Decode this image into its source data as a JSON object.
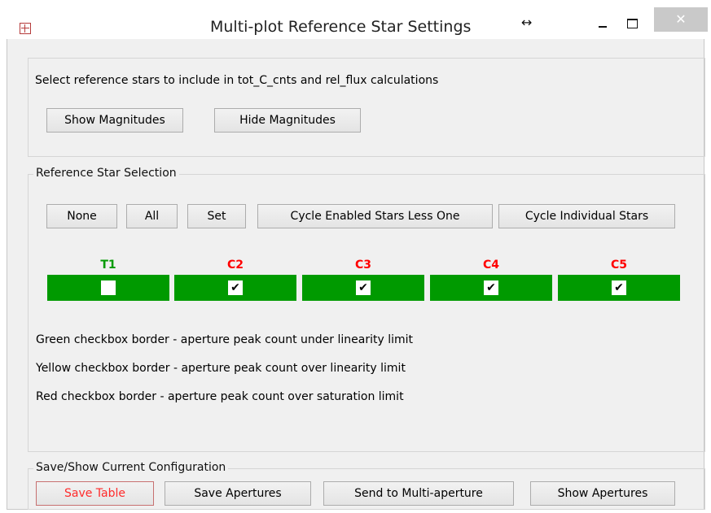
{
  "window": {
    "title": "Multi-plot Reference Star Settings",
    "resize_glyph": "↔",
    "close_glyph": "✕",
    "icons": {
      "app": "plot-app-icon",
      "resize": "horizontal-resize-icon",
      "minimize": "minimize-icon",
      "maximize": "maximize-icon",
      "close": "close-icon"
    }
  },
  "display_panel": {
    "instruction": "Select reference stars to include in tot_C_cnts and rel_flux calculations",
    "show_magnitudes": "Show Magnitudes",
    "hide_magnitudes": "Hide Magnitudes"
  },
  "selection_panel": {
    "legend": "Reference Star Selection",
    "buttons": {
      "none": "None",
      "all": "All",
      "set": "Set",
      "cycle_enabled": "Cycle Enabled Stars Less One",
      "cycle_individual": "Cycle Individual Stars"
    },
    "stars": [
      {
        "label": "T1",
        "label_color": "#009a00",
        "checked": false,
        "check_glyph": ""
      },
      {
        "label": "C2",
        "label_color": "#ff0000",
        "checked": true,
        "check_glyph": "✔"
      },
      {
        "label": "C3",
        "label_color": "#ff0000",
        "checked": true,
        "check_glyph": "✔"
      },
      {
        "label": "C4",
        "label_color": "#ff0000",
        "checked": true,
        "check_glyph": "✔"
      },
      {
        "label": "C5",
        "label_color": "#ff0000",
        "checked": true,
        "check_glyph": "✔"
      }
    ],
    "cell_color": "#009a00",
    "notes": [
      "Green checkbox border - aperture peak count under linearity limit",
      "Yellow checkbox border - aperture peak count over linearity limit",
      "Red checkbox border - aperture peak count over saturation limit"
    ]
  },
  "save_panel": {
    "legend": "Save/Show Current Configuration",
    "save_table": "Save Table",
    "save_apertures": "Save Apertures",
    "send_multi_aperture": "Send to Multi-aperture",
    "show_apertures": "Show Apertures"
  }
}
